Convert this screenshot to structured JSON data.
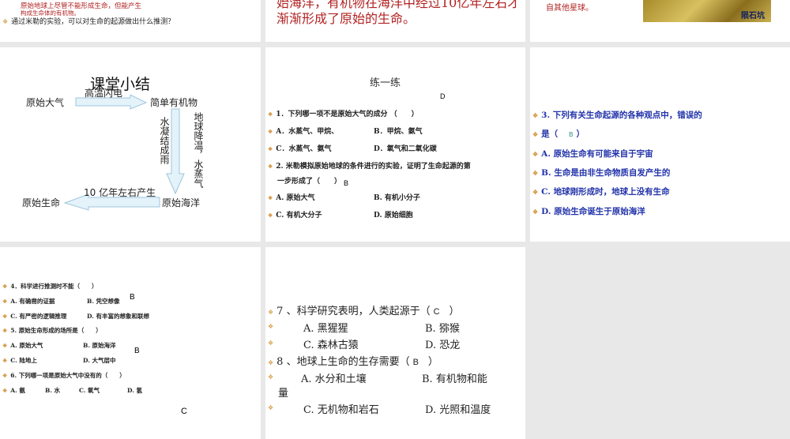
{
  "slides": {
    "s1": {
      "red_text_1": "原始地球上尽管不能形成生命，但能产生",
      "red_text_2": "构成生命体的有机物。",
      "bullet": "通过米勒的实验，可以对生命的起源做出什么推测？"
    },
    "s2": {
      "line1": "始海洋，有机物在海洋中经过10亿年左右才",
      "line2": "渐渐形成了原始的生命。"
    },
    "s3": {
      "text": "自其他星球。",
      "image_label": "陨石坑"
    },
    "s4": {
      "title": "课堂小结",
      "n1": "原始大气",
      "n2": "简单有机物",
      "n3": "原始海洋",
      "n4": "原始生命",
      "a1": "高温闪电",
      "a2_left": "水凝结成雨",
      "a2_right": "地球降温，水蒸气",
      "a3": "10 亿年左右产生"
    },
    "s5": {
      "title": "练一练",
      "ans1": "D",
      "q1": "1．下列哪一项不是原始大气的成分 （　　）",
      "q1a": "A．水蒸气、甲烷、",
      "q1b": "B．甲烷、氨气",
      "q1c": "C．水蒸气、氨气",
      "q1d": "D．氧气和二氧化碳",
      "q2": "2. 米勒模拟原始地球的条件进行的实验，证明了生命起源的第",
      "q2b": "一步形成了（　　）",
      "ans2": "B",
      "q2a_opt": "A. 原始大气",
      "q2b_opt": "B. 有机小分子",
      "q2c_opt": "C. 有机大分子",
      "q2d_opt": "D. 原始细胞"
    },
    "s6": {
      "q3": "3. 下列有关生命起源的各种观点中，错误的",
      "q3b": "是（",
      "ans": "B",
      "q3close": "）",
      "a": "A. 原始生命有可能来自于宇宙",
      "b": "B. 生命是由非生命物质自发产生的",
      "c": "C. 地球刚形成时，地球上没有生命",
      "d": "D. 原始生命诞生于原始海洋"
    },
    "s7": {
      "q4": "4．科学进行推测时不能（　　）",
      "q4a": "A. 有确凿的证据",
      "q4b": "B. 凭空想像",
      "ans4": "B",
      "q4c": "C. 有严密的逻辑推理",
      "q4d": "D. 有丰富的想象和联想",
      "q5": "5. 原始生命形成的场所是（　　）",
      "q5a": "A. 原始大气",
      "q5b": "B. 原始海洋",
      "ans5": "B",
      "q5c": "C. 陆地上",
      "q5d": "D. 大气层中",
      "q6": "6. 下列哪一项是原始大气中没有的（　　）",
      "q6a": "A. 氨",
      "q6b": "B. 水",
      "q6c": "C. 氧气",
      "q6d": "D. 氢",
      "ans6": "C"
    },
    "s8": {
      "q7": "7 、科学研究表明，人类起源于（",
      "ans7": "C",
      "close": "）",
      "q7a": "A. 黑猩猩",
      "q7b": "B. 猕猴",
      "q7c": "C. 森林古猿",
      "q7d": "D. 恐龙",
      "q8": "8 、地球上生命的生存需要（",
      "ans8": "B",
      "q8a": "A. 水分和土壤",
      "q8b": "B. 有机物和能",
      "q8b2": "量",
      "q8c": "C. 无机物和岩石",
      "q8d": "D. 光照和温度"
    }
  }
}
